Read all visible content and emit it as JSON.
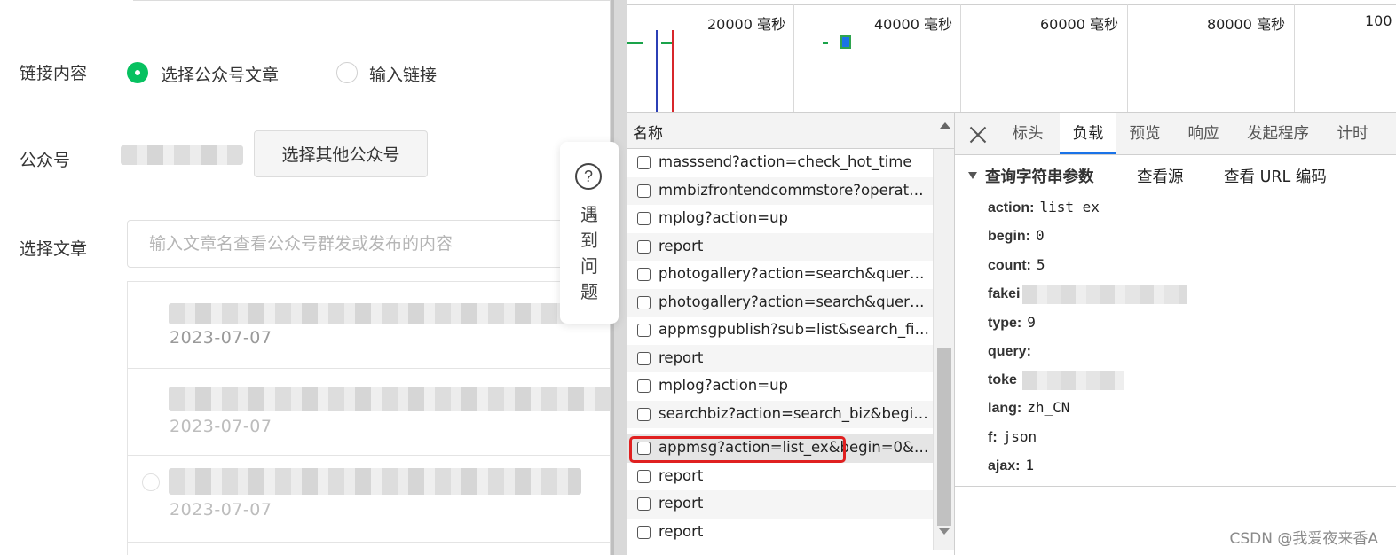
{
  "form": {
    "link_content_label": "链接内容",
    "radio_article_label": "选择公众号文章",
    "radio_link_label": "输入链接",
    "account_label": "公众号",
    "choose_other_account_button": "选择其他公众号",
    "select_article_label": "选择文章",
    "search_placeholder": "输入文章名查看公众号群发或发布的内容",
    "articles": [
      {
        "date": "2023-07-07"
      },
      {
        "date": "2023-07-07"
      },
      {
        "date": "2023-07-07"
      }
    ]
  },
  "help": {
    "icon_glyph": "?",
    "text": "遇到问题"
  },
  "timeline": {
    "ticks": [
      "20000 毫秒",
      "40000 毫秒",
      "60000 毫秒",
      "80000 毫秒",
      "100"
    ]
  },
  "network": {
    "header_name": "名称",
    "requests": [
      "masssend?action=check_hot_time",
      "mmbizfrontendcommstore?operate_...",
      "mplog?action=up",
      "report",
      "photogallery?action=search&query=...",
      "photogallery?action=search&query=...",
      "appmsgpublish?sub=list&search_fiel...",
      "report",
      "mplog?action=up",
      "searchbiz?action=search_biz&begin...",
      "appmsg?action=list_ex&begin=0&c...",
      "report",
      "report",
      "report"
    ],
    "selected_index": 10
  },
  "details": {
    "tabs": [
      "标头",
      "负载",
      "预览",
      "响应",
      "发起程序",
      "计时"
    ],
    "active_tab": "负载",
    "section_title": "查询字符串参数",
    "view_source": "查看源",
    "view_url_encoded": "查看 URL 编码",
    "params": [
      {
        "key": "action:",
        "value": "list_ex"
      },
      {
        "key": "begin:",
        "value": "0"
      },
      {
        "key": "count:",
        "value": "5"
      },
      {
        "key": "fakei",
        "value": ""
      },
      {
        "key": "type:",
        "value": "9"
      },
      {
        "key": "query:",
        "value": ""
      },
      {
        "key": "toke",
        "value": ""
      },
      {
        "key": "lang:",
        "value": "zh_CN"
      },
      {
        "key": "f:",
        "value": "json"
      },
      {
        "key": "ajax:",
        "value": "1"
      }
    ]
  },
  "watermark": "CSDN @我爱夜来香A",
  "colors": {
    "accent_green": "#07c160",
    "tab_underline": "#1a73e8",
    "highlight_red": "#e02020"
  }
}
